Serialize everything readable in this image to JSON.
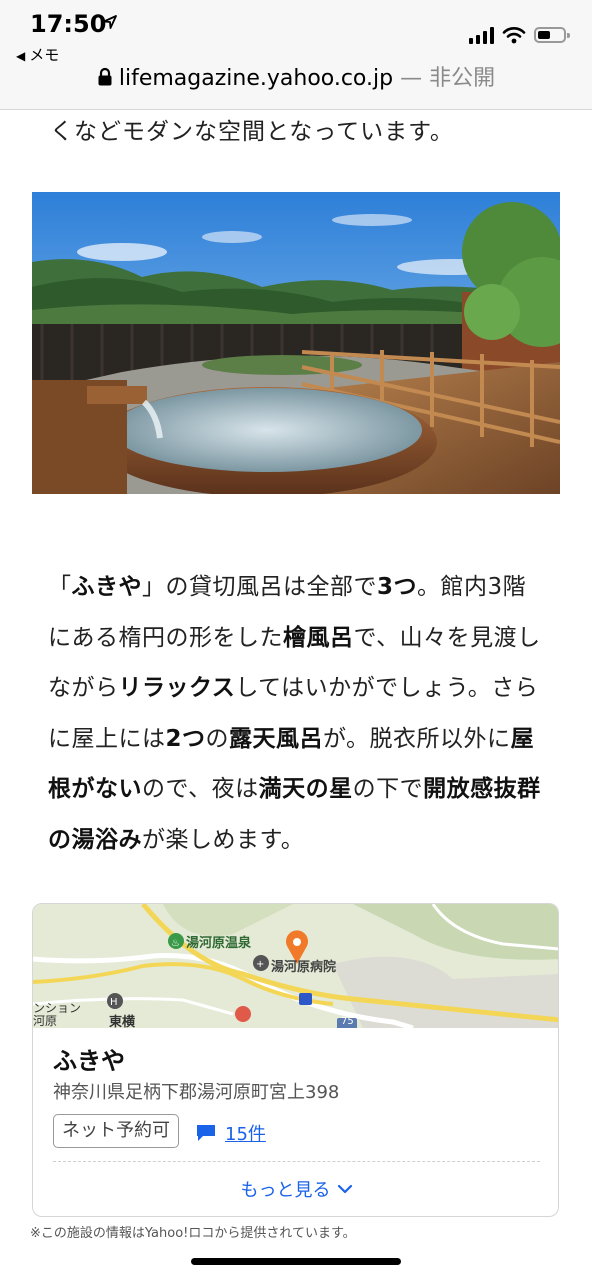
{
  "status_bar": {
    "time": "17:50",
    "back_label": "メモ"
  },
  "address_bar": {
    "domain": "lifemagazine.yahoo.co.jp",
    "separator": " — ",
    "privacy": "非公開"
  },
  "article": {
    "lead_text": "くなどモダンな空間となっています。",
    "body": [
      {
        "t": "「"
      },
      {
        "t": "ふきや",
        "b": true
      },
      {
        "t": "」の貸切風呂は全部で"
      },
      {
        "t": "3つ",
        "b": true
      },
      {
        "t": "。館内3階にある楕円の形をした"
      },
      {
        "t": "檜風呂",
        "b": true
      },
      {
        "t": "で、山々を見渡しながら"
      },
      {
        "t": "リラックス",
        "b": true
      },
      {
        "t": "してはいかがでしょう。さらに屋上には"
      },
      {
        "t": "2つ",
        "b": true
      },
      {
        "t": "の"
      },
      {
        "t": "露天風呂",
        "b": true
      },
      {
        "t": "が。脱衣所以外に"
      },
      {
        "t": "屋根がない",
        "b": true
      },
      {
        "t": "ので、夜は"
      },
      {
        "t": "満天の星",
        "b": true
      },
      {
        "t": "の下で"
      },
      {
        "t": "開放感抜群の湯浴み",
        "b": true
      },
      {
        "t": "が楽しめます。"
      }
    ]
  },
  "place_card": {
    "map_labels": {
      "onsen": "湯河原温泉",
      "hospital": "湯河原病院",
      "hotel": "東横",
      "mansion_1": "ンション",
      "mansion_2": "河原",
      "route": "75"
    },
    "name": "ふきや",
    "address": "神奈川県足柄下郡湯河原町宮上398",
    "tag": "ネット予約可",
    "review_count": "15件",
    "more_label": "もっと見る",
    "colors": {
      "link": "#1a62e8",
      "pin": "#f07a2a"
    }
  },
  "footnote": "※この施設の情報はYahoo!ロコから提供されています。"
}
